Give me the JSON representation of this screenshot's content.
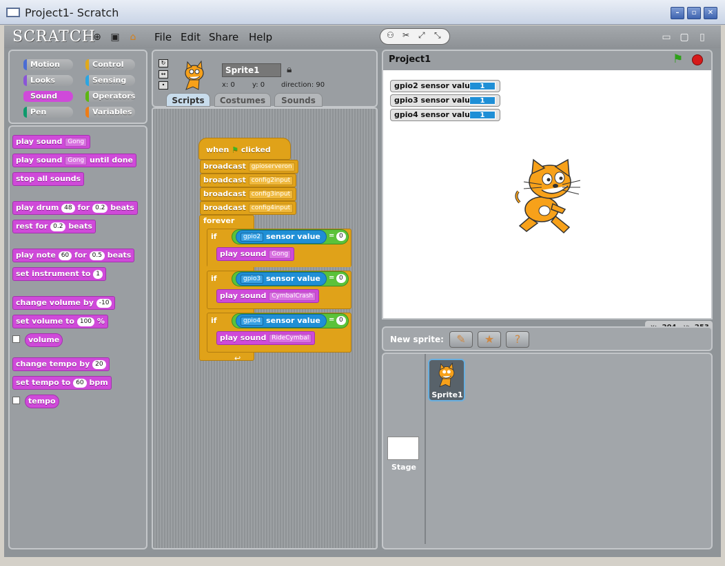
{
  "window": {
    "title": "Project1- Scratch",
    "min": "–",
    "max": "▫",
    "close": "✕"
  },
  "menu": {
    "logo": "SCRATCH",
    "file": "File",
    "edit": "Edit",
    "share": "Share",
    "help": "Help"
  },
  "categories": [
    {
      "label": "Motion",
      "color": "#4a6cd4"
    },
    {
      "label": "Control",
      "color": "#e1a91a"
    },
    {
      "label": "Looks",
      "color": "#8a55d7"
    },
    {
      "label": "Sensing",
      "color": "#2ca5e2"
    },
    {
      "label": "Sound",
      "color": "#cf4ad9"
    },
    {
      "label": "Operators",
      "color": "#5cb712"
    },
    {
      "label": "Pen",
      "color": "#0e9a6c"
    },
    {
      "label": "Variables",
      "color": "#ee7d16"
    }
  ],
  "palette": {
    "play_sound": "play sound",
    "gong": "Gong",
    "until_done": "until done",
    "stop_all": "stop all sounds",
    "play_drum": "play drum",
    "drum_val": "48",
    "for": "for",
    "drum_beats": "0.2",
    "beats": "beats",
    "rest_for": "rest for",
    "rest_beats": "0.2",
    "play_note": "play note",
    "note_val": "60",
    "note_beats": "0.5",
    "set_instrument": "set instrument to",
    "instrument_val": "1",
    "change_volume": "change volume by",
    "volume_delta": "-10",
    "set_volume": "set volume to",
    "volume_val": "100",
    "percent": "%",
    "volume": "volume",
    "change_tempo": "change tempo by",
    "tempo_delta": "20",
    "set_tempo": "set tempo to",
    "tempo_val": "60",
    "bpm": "bpm",
    "tempo": "tempo"
  },
  "sprite": {
    "name": "Sprite1",
    "x_label": "x:",
    "x": "0",
    "y_label": "y:",
    "y": "0",
    "dir_label": "direction:",
    "direction": "90"
  },
  "tabs": [
    "Scripts",
    "Costumes",
    "Sounds"
  ],
  "script": {
    "when": "when",
    "clicked": "clicked",
    "broadcast": "broadcast",
    "msgs": [
      "gpioserveron",
      "config2input",
      "config3input",
      "config4input"
    ],
    "forever": "forever",
    "if": "if",
    "sensor_value": "sensor value",
    "eq": "=",
    "zero": "0",
    "conds": [
      "gpio2",
      "gpio3",
      "gpio4"
    ],
    "play_sound": "play sound",
    "sounds": [
      "Gong",
      "CymbalCrash",
      "RideCymbal"
    ]
  },
  "stage": {
    "title": "Project1",
    "monitors": [
      {
        "label": "gpio2 sensor value",
        "value": "1"
      },
      {
        "label": "gpio3 sensor value",
        "value": "1"
      },
      {
        "label": "gpio4 sensor value",
        "value": "1"
      }
    ],
    "mouse_x_label": "x:",
    "mouse_x": "-204",
    "mouse_y_label": "y:",
    "mouse_y": "-253"
  },
  "sprite_list": {
    "new_sprite": "New sprite:",
    "stage_label": "Stage",
    "sprite1": "Sprite1"
  }
}
